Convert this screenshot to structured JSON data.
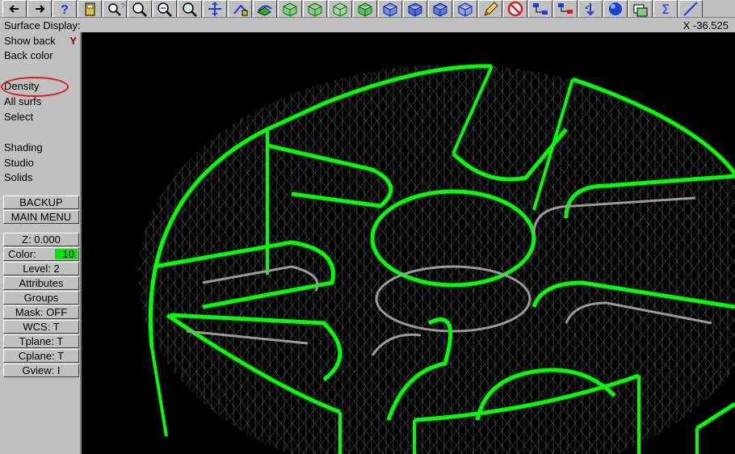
{
  "toolbar": {
    "icons": [
      "arrow-left-icon",
      "arrow-right-icon",
      "help-icon",
      "calculator-icon",
      "zoom-query-icon",
      "zoom-icon",
      "zoom-out-icon",
      "zoom-window-icon",
      "pan-icon",
      "analyze-icon",
      "rotate-icon",
      "cube-top-icon",
      "cube-front-icon",
      "cube-side-icon",
      "cube-iso-icon",
      "cube-blue-1-icon",
      "cube-blue-2-icon",
      "cube-blue-3-icon",
      "cube-blue-4-icon",
      "pencil-icon",
      "no-entry-icon",
      "tree-icon",
      "tree-multi-icon",
      "arrow-down-icon",
      "sphere-icon",
      "layer-icon",
      "sigma-icon",
      "line-icon"
    ]
  },
  "status": {
    "title": "Surface Display:",
    "coord": "X -36.525"
  },
  "menu": {
    "show_back": "Show back",
    "show_back_flag": "Y",
    "back_color": "Back color",
    "density": "Density",
    "all_surfs": "All surfs",
    "select": "Select",
    "shading": "Shading",
    "studio": "Studio",
    "solids": "Solids",
    "backup": "BACKUP",
    "main_menu": "MAIN MENU"
  },
  "params": {
    "z": "Z:  0.000",
    "color_label": "Color:",
    "color_value": "10",
    "level": "Level:  2",
    "attributes": "Attributes",
    "groups": "Groups",
    "mask": "Mask:  OFF",
    "wcs": "WCS:   T",
    "tplane": "Tplane:  T",
    "cplane": "Cplane:  T",
    "gview": "Gview:   I"
  },
  "colors": {
    "wire_primary": "#00ff00",
    "wire_secondary": "#9a9a9a",
    "menu_bg": "#c0c0c0",
    "color_swatch": "#0be00b",
    "highlight_circle": "#e01818"
  }
}
